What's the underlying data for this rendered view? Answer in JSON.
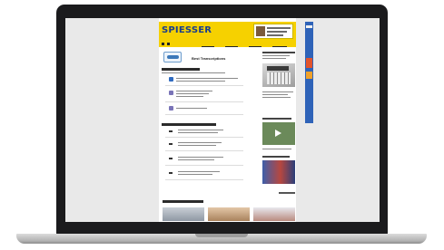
{
  "site": {
    "logo": "SPIESSER",
    "nav_items": [
      "",
      "",
      "",
      "",
      ""
    ],
    "seo_title": "Best Transcriptions"
  },
  "colors": {
    "header_yellow": "#f6d100",
    "logo_blue": "#1a3e8c",
    "sidebar_ad_blue": "#2f63b8",
    "laptop_body": "#1b1b1d"
  },
  "icons": {
    "list_icons": [
      "calendar-icon",
      "document-icon",
      "document-icon"
    ],
    "video_play": "play-icon"
  }
}
